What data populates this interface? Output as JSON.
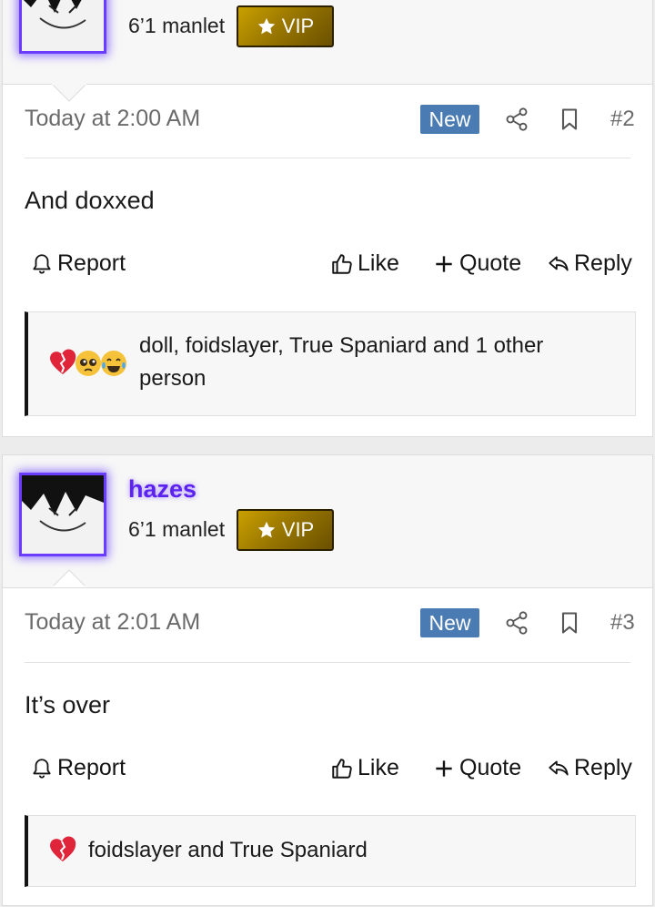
{
  "post1": {
    "user_title": "6’1 manlet",
    "vip_label": "VIP",
    "time": "Today at 2:00 AM",
    "new_label": "New",
    "number": "#2",
    "message": "And doxxed",
    "report": "Report",
    "like": "Like",
    "quote": "Quote",
    "reply": "Reply",
    "reactions_text": "doll, foidslayer, True Spaniard and 1 other person",
    "reaction_icons": [
      "broken-heart-icon",
      "pleading-face-icon",
      "tears-of-joy-icon"
    ]
  },
  "post2": {
    "username": "hazes",
    "user_title": "6’1 manlet",
    "vip_label": "VIP",
    "time": "Today at 2:01 AM",
    "new_label": "New",
    "number": "#3",
    "message": "It’s over",
    "report": "Report",
    "like": "Like",
    "quote": "Quote",
    "reply": "Reply",
    "reactions_text": "foidslayer and True Spaniard",
    "reaction_icons": [
      "broken-heart-icon"
    ]
  },
  "colors": {
    "username": "#5b22f0",
    "new_badge": "#4a7bb2",
    "vip_gold": "#9b7800",
    "avatar_glow": "#6a3cff"
  }
}
